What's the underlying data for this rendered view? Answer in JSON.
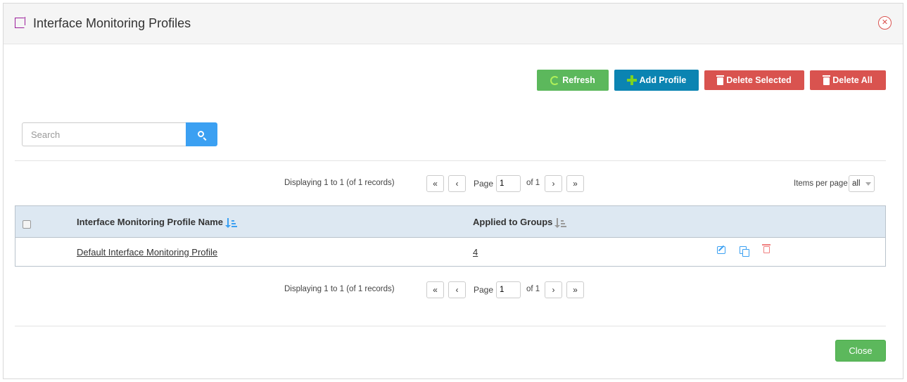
{
  "dialog": {
    "title": "Interface Monitoring Profiles",
    "close_glyph": "✕"
  },
  "toolbar": {
    "refresh_label": "Refresh",
    "add_label": "Add Profile",
    "delete_selected_label": "Delete Selected",
    "delete_all_label": "Delete All"
  },
  "search": {
    "placeholder": "Search",
    "value": ""
  },
  "pager_top": {
    "info": "Displaying 1 to 1 (of 1 records)",
    "first": "«",
    "prev": "‹",
    "page_label": "Page",
    "page_value": "1",
    "of_label": "of 1",
    "next": "›",
    "last": "»",
    "items_per_page_label": "Items per page",
    "items_per_page_value": "all"
  },
  "table": {
    "columns": [
      "Interface Monitoring Profile Name",
      "Applied to Groups"
    ],
    "rows": [
      {
        "name": "Default Interface Monitoring Profile",
        "groups": "4"
      }
    ]
  },
  "pager_bottom": {
    "info": "Displaying 1 to 1 (of 1 records)",
    "first": "«",
    "prev": "‹",
    "page_label": "Page",
    "page_value": "1",
    "of_label": "of 1",
    "next": "›",
    "last": "»"
  },
  "footer": {
    "close_label": "Close"
  },
  "colors": {
    "success": "#5cb85c",
    "primary": "#0b84b2",
    "danger": "#d9534f",
    "accent_blue": "#3ba0f2",
    "header_bg": "#dde8f2"
  }
}
